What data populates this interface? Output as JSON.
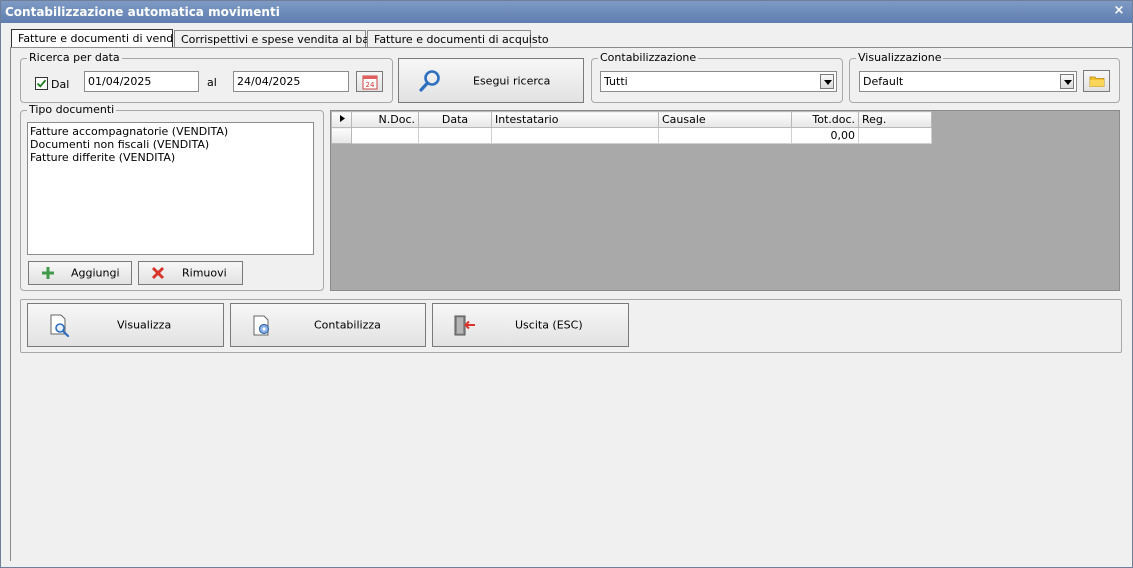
{
  "window": {
    "title": "Contabilizzazione automatica movimenti",
    "close_symbol": "×"
  },
  "tabs": [
    {
      "label": "Fatture e documenti di vendita",
      "active": true
    },
    {
      "label": "Corrispettivi e spese vendita al banco",
      "active": false
    },
    {
      "label": "Fatture e documenti di acquisto",
      "active": false
    }
  ],
  "search_by_date": {
    "group_label": "Ricerca per data",
    "from_checkbox_label": "Dal",
    "from_checked": true,
    "from_value": "01/04/2025",
    "to_label": "al",
    "to_value": "24/04/2025",
    "calendar_icon_text": "24"
  },
  "search_button": {
    "label": "Esegui ricerca"
  },
  "accounting": {
    "group_label": "Contabilizzazione",
    "selected": "Tutti"
  },
  "view": {
    "group_label": "Visualizzazione",
    "selected": "Default"
  },
  "document_types": {
    "group_label": "Tipo documenti",
    "items": [
      "Fatture accompagnatorie (VENDITA)",
      "Documenti non fiscali (VENDITA)",
      "Fatture differite (VENDITA)"
    ],
    "add_label": "Aggiungi",
    "remove_label": "Rimuovi"
  },
  "grid": {
    "columns": [
      "N.Doc.",
      "Data",
      "Intestatario",
      "Causale",
      "Tot.doc.",
      "Reg."
    ],
    "rows": [
      [
        "",
        "",
        "",
        "",
        "0,00",
        ""
      ]
    ]
  },
  "actions": {
    "view_label": "Visualizza",
    "post_label": "Contabilizza",
    "exit_label": "Uscita (ESC)"
  },
  "colors": {
    "titlebar": "#6b88b8",
    "grid_background": "#a9a9a9",
    "remove_icon": "#d9362b",
    "add_icon": "#3f9a4a"
  }
}
